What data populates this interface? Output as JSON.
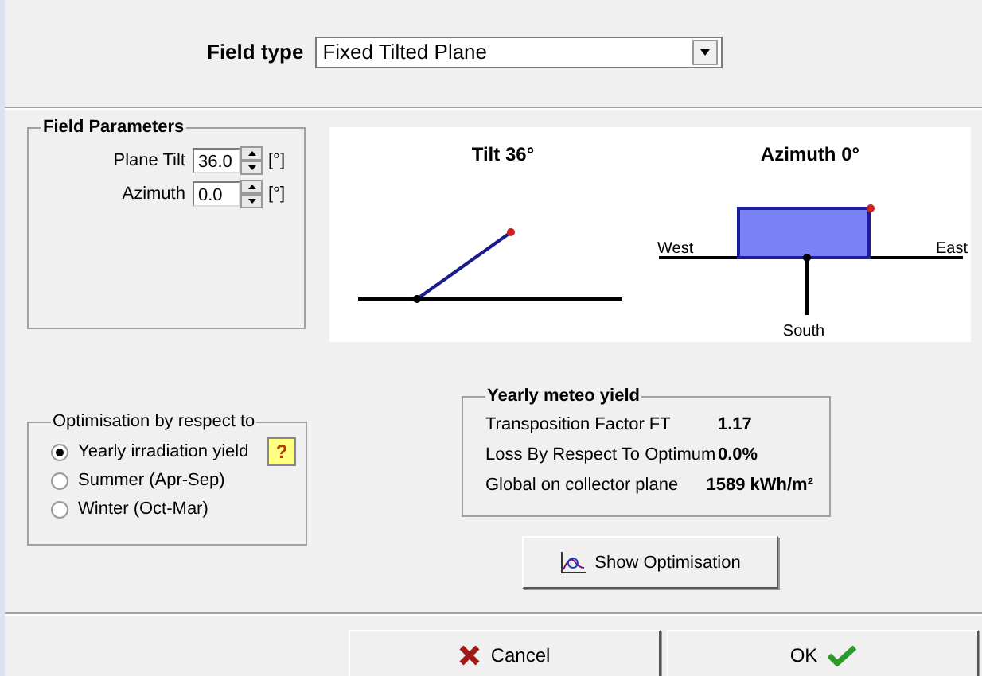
{
  "field_type": {
    "label": "Field type",
    "value": "Fixed Tilted Plane"
  },
  "field_parameters": {
    "title": "Field Parameters",
    "params": [
      {
        "label": "Plane Tilt",
        "value": "36.0",
        "unit": "[°]"
      },
      {
        "label": "Azimuth",
        "value": "0.0",
        "unit": "[°]"
      }
    ]
  },
  "diagrams": {
    "tilt_title": "Tilt 36°",
    "azimuth_title": "Azimuth 0°",
    "west": "West",
    "east": "East",
    "south": "South"
  },
  "optimisation": {
    "title": "Optimisation by respect to",
    "help": "?",
    "options": [
      {
        "label": "Yearly irradiation yield",
        "selected": true
      },
      {
        "label": "Summer (Apr-Sep)",
        "selected": false
      },
      {
        "label": "Winter (Oct-Mar)",
        "selected": false
      }
    ]
  },
  "yearly_meteo_yield": {
    "title": "Yearly meteo yield",
    "rows": [
      {
        "label": "Transposition Factor FT",
        "value": "1.17"
      },
      {
        "label": "Loss By Respect To Optimum",
        "value": "0.0%"
      },
      {
        "label": "Global on collector plane",
        "value": "1589 kWh/m²"
      }
    ]
  },
  "show_optimisation": "Show Optimisation",
  "buttons": [
    {
      "kind": "cancel",
      "label": "Cancel"
    },
    {
      "kind": "ok",
      "label": "OK"
    }
  ]
}
